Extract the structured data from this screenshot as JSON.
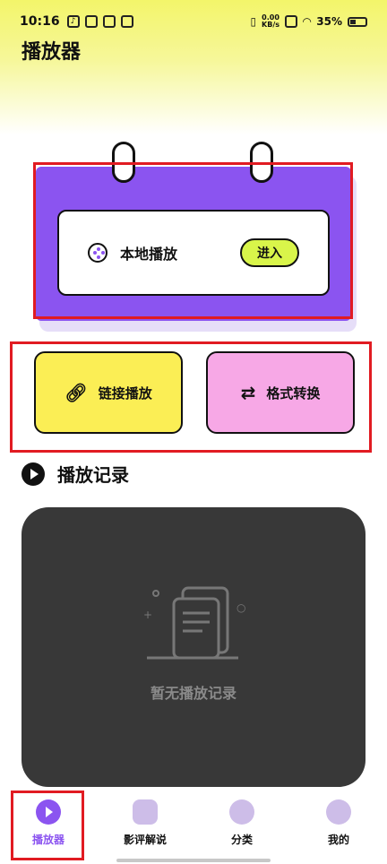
{
  "status_bar": {
    "time": "10:16",
    "net_speed_value": "0.00",
    "net_speed_unit": "KB/s",
    "battery": "35%",
    "battery_fraction": 0.35
  },
  "header": {
    "title": "播放器"
  },
  "local_play": {
    "label": "本地播放",
    "enter_label": "进入"
  },
  "actions": [
    {
      "label": "链接播放",
      "icon": "link-icon"
    },
    {
      "label": "格式转换",
      "icon": "convert-icon"
    }
  ],
  "history": {
    "title": "播放记录",
    "empty_text": "暂无播放记录"
  },
  "bottom_nav": [
    {
      "label": "播放器",
      "icon": "play-icon",
      "active": true
    },
    {
      "label": "影评解说",
      "icon": "film-reel-icon",
      "active": false
    },
    {
      "label": "分类",
      "icon": "pie-chart-icon",
      "active": false
    },
    {
      "label": "我的",
      "icon": "person-icon",
      "active": false
    }
  ],
  "colors": {
    "accent_purple": "#8b54f0",
    "link_card": "#fbee55",
    "convert_card": "#f7a8e6",
    "enter_button": "#d9f54a",
    "highlight_red": "#e11b22"
  }
}
